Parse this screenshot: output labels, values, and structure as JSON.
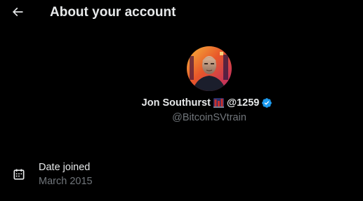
{
  "header": {
    "back_icon": "arrow-left-icon",
    "title": "About your account"
  },
  "profile": {
    "avatar_icon": "profile-avatar",
    "display_name": "Jon Southurst",
    "display_name_emoji": "flag-icon",
    "display_name_suffix": "@1259",
    "verified_icon": "verified-badge-icon",
    "verified_color": "#1d9bf0",
    "handle": "@BitcoinSVtrain"
  },
  "details": [
    {
      "icon": "calendar-icon",
      "label": "Date joined",
      "value": "March 2015"
    }
  ],
  "colors": {
    "background": "#000000",
    "primary_text": "#e7e9ea",
    "secondary_text": "#71767b",
    "accent": "#1d9bf0"
  }
}
